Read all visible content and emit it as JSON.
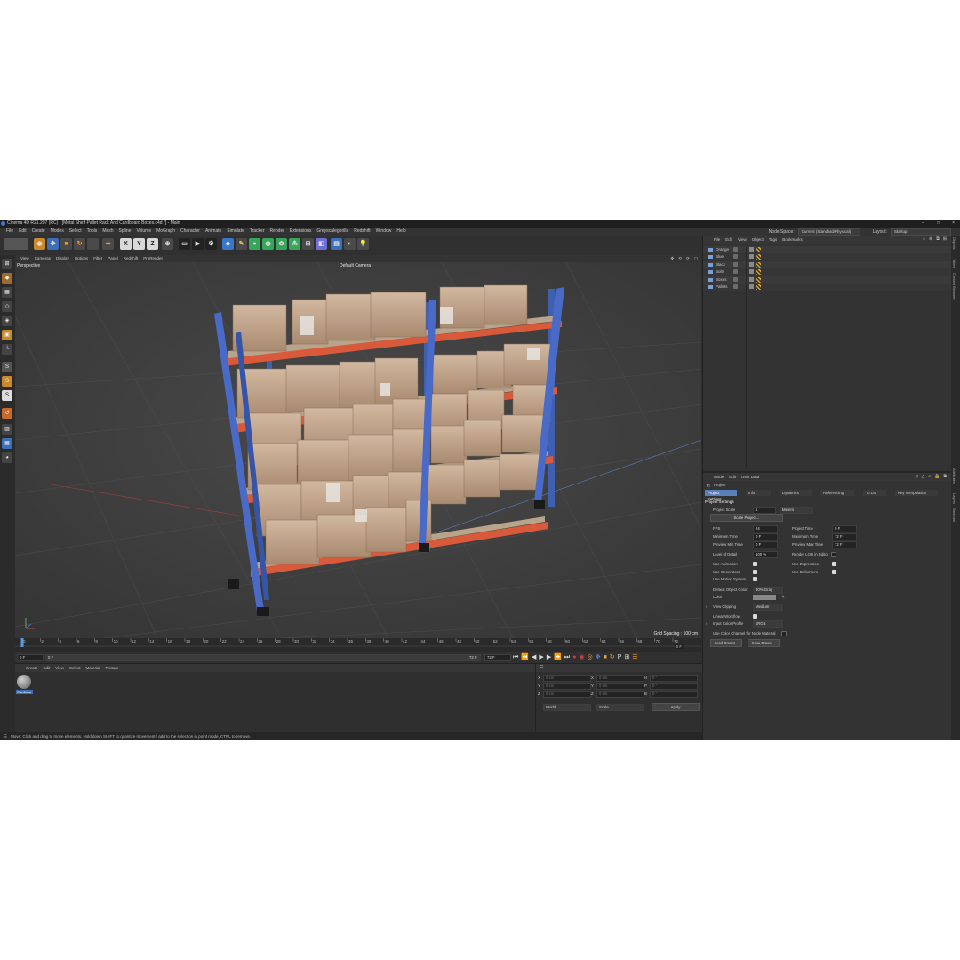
{
  "window": {
    "title": "Cinema 4D R21.207 (RC) - [Metal Shelf Pallet Rack And Cardboard Boxes.c4d *] - Main",
    "controls": [
      "–",
      "□",
      "×"
    ]
  },
  "menubar": {
    "items": [
      "File",
      "Edit",
      "Create",
      "Modes",
      "Select",
      "Tools",
      "Mesh",
      "Spline",
      "Volume",
      "MoGraph",
      "Character",
      "Animate",
      "Simulate",
      "Tracker",
      "Render",
      "Extensions",
      "Greyscalegorilla",
      "Redshift",
      "Window",
      "Help"
    ],
    "node_space_label": "Node Space:",
    "node_space_value": "Current (Standard/Physical)",
    "layout_label": "Layout:",
    "layout_value": "Startup"
  },
  "toolbar": {
    "x_label": "X",
    "y_label": "Y",
    "z_label": "Z"
  },
  "viewport": {
    "menu": [
      "View",
      "Cameras",
      "Display",
      "Options",
      "Filter",
      "Panel",
      "Redshift",
      "ProRender"
    ],
    "view_name": "Perspective",
    "camera": "Default Camera",
    "grid_spacing": "Grid Spacing : 100 cm"
  },
  "timeline": {
    "ticks": [
      "0",
      "2",
      "4",
      "6",
      "8",
      "10",
      "12",
      "14",
      "16",
      "18",
      "20",
      "22",
      "24",
      "26",
      "28",
      "30",
      "32",
      "34",
      "36",
      "38",
      "40",
      "42",
      "44",
      "46",
      "48",
      "50",
      "52",
      "54",
      "56",
      "58",
      "60",
      "62",
      "64",
      "66",
      "68",
      "70",
      "72"
    ],
    "current_frame": "0 F",
    "start_field": "0 F",
    "start_field2": "0 F",
    "end_field": "72 F",
    "end_field2": "72 F"
  },
  "material_manager": {
    "menu": [
      "Create",
      "Edit",
      "View",
      "Select",
      "Material",
      "Texture"
    ],
    "materials": [
      {
        "name": "Cardboar"
      }
    ]
  },
  "coord_manager": {
    "rows": [
      {
        "a": "X",
        "av": "0 cm",
        "b": "X",
        "bv": "0 cm",
        "c": "H",
        "cv": "0 °"
      },
      {
        "a": "Y",
        "av": "0 cm",
        "b": "Y",
        "bv": "0 cm",
        "c": "P",
        "cv": "0 °"
      },
      {
        "a": "Z",
        "av": "0 cm",
        "b": "Z",
        "bv": "0 cm",
        "c": "B",
        "cv": "0 °"
      }
    ],
    "mode1": "World",
    "mode2": "Scale",
    "apply": "Apply"
  },
  "statusbar": {
    "text": "Move: Click and drag to move elements. Hold down SHIFT to quantize movement / add to the selection in point mode, CTRL to remove."
  },
  "object_manager": {
    "menu": [
      "File",
      "Edit",
      "View",
      "Object",
      "Tags",
      "Bookmarks"
    ],
    "objects": [
      {
        "name": "Orange",
        "color": "#7aa0d8"
      },
      {
        "name": "Blue",
        "color": "#7aa0d8"
      },
      {
        "name": "Black",
        "color": "#7aa0d8"
      },
      {
        "name": "Bolts",
        "color": "#7aa0d8"
      },
      {
        "name": "Boxes",
        "color": "#7aa0d8"
      },
      {
        "name": "Pallets",
        "color": "#7aa0d8"
      }
    ]
  },
  "right_tabs": [
    "Objects",
    "Takes",
    "Content Browser",
    "Attributes",
    "Layers",
    "Structure"
  ],
  "attributes": {
    "menu": [
      "Mode",
      "Edit",
      "User Data"
    ],
    "object_label": "Project",
    "tabs": [
      "Project Settings",
      "Info",
      "Dynamics",
      "Referencing",
      "To Do",
      "Key Interpolation"
    ],
    "section_title": "Project Settings",
    "project_scale_label": "Project Scale",
    "project_scale_value": "1",
    "project_scale_unit": "Meters",
    "scale_project_btn": "Scale Project...",
    "fps_label": "FPS",
    "fps_value": "24",
    "project_time_label": "Project Time",
    "project_time_value": "0 F",
    "min_time_label": "Minimum Time",
    "min_time_value": "0 F",
    "max_time_label": "Maximum Time",
    "max_time_value": "72 F",
    "prev_min_label": "Preview Min Time",
    "prev_min_value": "0 F",
    "prev_max_label": "Preview Max Time",
    "prev_max_value": "72 F",
    "lod_label": "Level of Detail",
    "lod_value": "100 %",
    "render_lod_label": "Render LOD in Editor",
    "use_animation": "Use Animation",
    "use_expression": "Use Expression",
    "use_generators": "Use Generators",
    "use_deformers": "Use Deformers",
    "use_motion": "Use Motion System",
    "default_color_label": "Default Object Color",
    "default_color_value": "80% Gray",
    "color_label": "Color",
    "view_clipping_label": "View Clipping",
    "view_clipping_value": "Medium",
    "linear_workflow_label": "Linear Workflow",
    "input_profile_label": "Input Color Profile",
    "input_profile_value": "sRGB",
    "use_color_channel_label": "Use Color Channel for Node Material",
    "load_preset": "Load Preset...",
    "save_preset": "Save Preset..."
  }
}
